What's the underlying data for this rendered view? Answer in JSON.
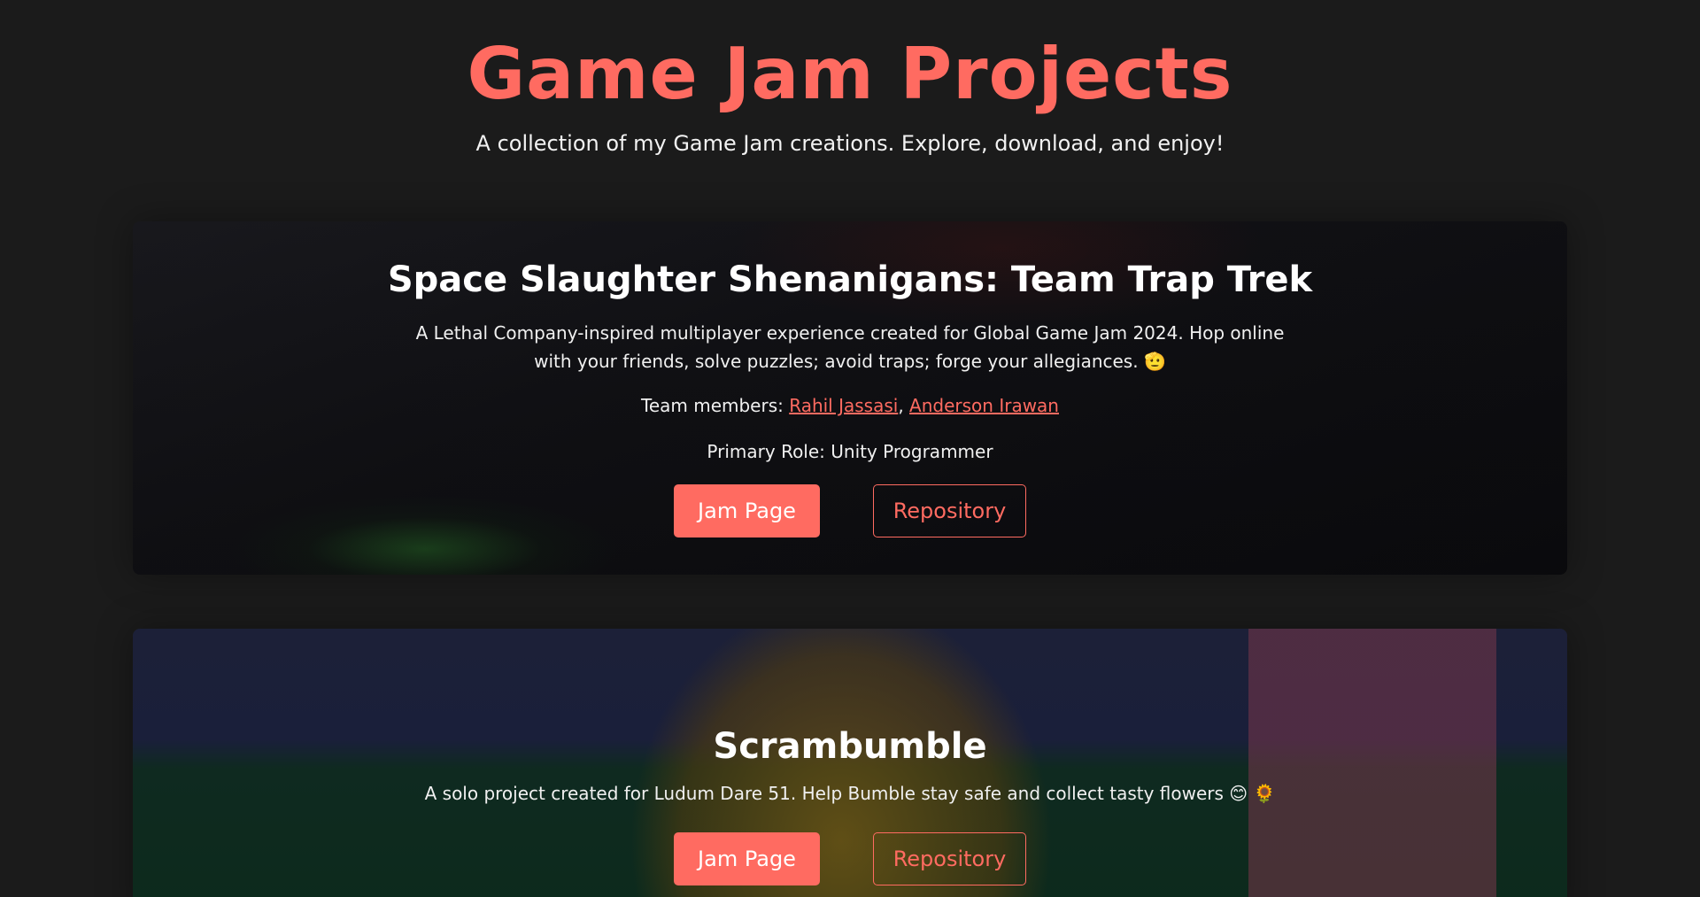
{
  "header": {
    "title": "Game Jam Projects",
    "subtitle": "A collection of my Game Jam creations. Explore, download, and enjoy!"
  },
  "projects": [
    {
      "title": "Space Slaughter Shenanigans: Team Trap Trek",
      "description": "A Lethal Company-inspired multiplayer experience created for Global Game Jam 2024. Hop online with your friends, solve puzzles; avoid traps; forge your allegiances. 🫡",
      "team_label": "Team members:",
      "team_members": [
        "Rahil Jassasi",
        "Anderson Irawan"
      ],
      "separator": ",",
      "role": "Primary Role: Unity Programmer",
      "primary_button": "Jam Page",
      "secondary_button": "Repository"
    },
    {
      "title": "Scrambumble",
      "description": "A solo project created for Ludum Dare 51. Help Bumble stay safe and collect tasty flowers 😊 🌻",
      "primary_button": "Jam Page",
      "secondary_button": "Repository"
    }
  ],
  "colors": {
    "accent": "#ff6b61",
    "background": "#1b1b1b",
    "text": "#ffffff"
  }
}
